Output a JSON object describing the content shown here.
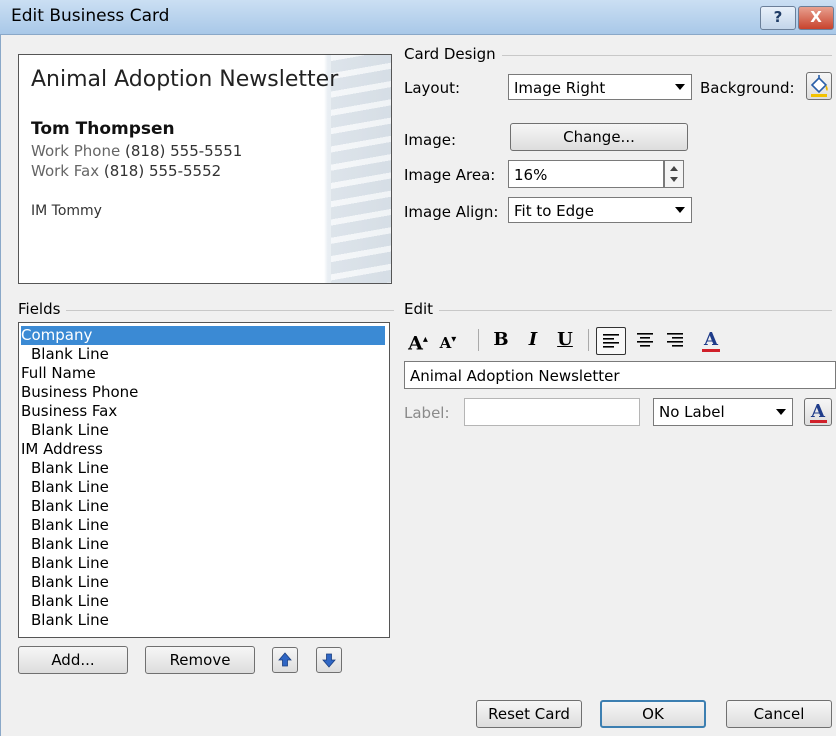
{
  "window": {
    "title": "Edit Business Card",
    "help_label": "?",
    "close_label": "X"
  },
  "card_preview": {
    "company": "Animal Adoption Newsletter",
    "name": "Tom Thompsen",
    "work_phone_label": "Work Phone",
    "work_phone": "(818) 555-5551",
    "work_fax_label": "Work Fax",
    "work_fax": "(818) 555-5552",
    "im": "IM Tommy"
  },
  "card_design": {
    "group_label": "Card Design",
    "layout_label": "Layout:",
    "layout_value": "Image Right",
    "background_label": "Background:",
    "image_label": "Image:",
    "change_button": "Change...",
    "image_area_label": "Image Area:",
    "image_area_value": "16%",
    "image_align_label": "Image Align:",
    "image_align_value": "Fit to Edge"
  },
  "fields": {
    "group_label": "Fields",
    "items": [
      {
        "text": "Company",
        "indent": false,
        "selected": true
      },
      {
        "text": "Blank Line",
        "indent": true
      },
      {
        "text": "Full Name",
        "indent": false
      },
      {
        "text": "Business Phone",
        "indent": false
      },
      {
        "text": "Business Fax",
        "indent": false
      },
      {
        "text": "Blank Line",
        "indent": true
      },
      {
        "text": "IM Address",
        "indent": false
      },
      {
        "text": "Blank Line",
        "indent": true
      },
      {
        "text": "Blank Line",
        "indent": true
      },
      {
        "text": "Blank Line",
        "indent": true
      },
      {
        "text": "Blank Line",
        "indent": true
      },
      {
        "text": "Blank Line",
        "indent": true
      },
      {
        "text": "Blank Line",
        "indent": true
      },
      {
        "text": "Blank Line",
        "indent": true
      },
      {
        "text": "Blank Line",
        "indent": true
      },
      {
        "text": "Blank Line",
        "indent": true
      }
    ],
    "add_button": "Add...",
    "remove_button": "Remove"
  },
  "edit": {
    "group_label": "Edit",
    "grow_font": "A",
    "shrink_font": "A",
    "bold": "B",
    "italic": "I",
    "underline": "U",
    "font_color": "A",
    "text_value": "Animal Adoption Newsletter",
    "label_label": "Label:",
    "label_value": "",
    "label_position": "No Label",
    "label_color": "A"
  },
  "buttons": {
    "reset": "Reset Card",
    "ok": "OK",
    "cancel": "Cancel"
  },
  "colors": {
    "selection": "#3b8ad4",
    "font_color_bar": "#d0202a",
    "titlebar": "#b8d3ef"
  }
}
